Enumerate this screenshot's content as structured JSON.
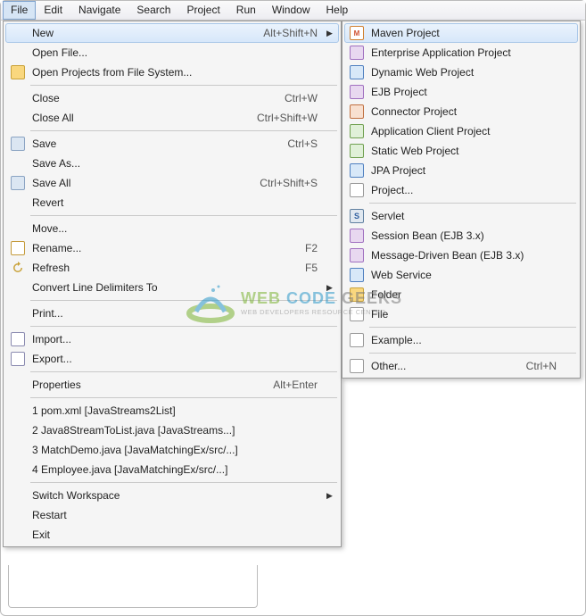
{
  "menubar": {
    "items": [
      "File",
      "Edit",
      "Navigate",
      "Search",
      "Project",
      "Run",
      "Window",
      "Help"
    ]
  },
  "file_menu": {
    "groups": [
      [
        {
          "label": "New",
          "shortcut": "Alt+Shift+N",
          "submenu": true,
          "highlighted": true,
          "icon": ""
        },
        {
          "label": "Open File...",
          "icon": ""
        },
        {
          "label": "Open Projects from File System...",
          "icon": "folder"
        }
      ],
      [
        {
          "label": "Close",
          "shortcut": "Ctrl+W"
        },
        {
          "label": "Close All",
          "shortcut": "Ctrl+Shift+W"
        }
      ],
      [
        {
          "label": "Save",
          "shortcut": "Ctrl+S",
          "icon": "save"
        },
        {
          "label": "Save As..."
        },
        {
          "label": "Save All",
          "shortcut": "Ctrl+Shift+S",
          "icon": "save"
        },
        {
          "label": "Revert"
        }
      ],
      [
        {
          "label": "Move..."
        },
        {
          "label": "Rename...",
          "shortcut": "F2",
          "icon": "edit"
        },
        {
          "label": "Refresh",
          "shortcut": "F5",
          "icon": "refresh"
        },
        {
          "label": "Convert Line Delimiters To",
          "submenu": true
        }
      ],
      [
        {
          "label": "Print..."
        }
      ],
      [
        {
          "label": "Import...",
          "icon": "import"
        },
        {
          "label": "Export...",
          "icon": "import"
        }
      ],
      [
        {
          "label": "Properties",
          "shortcut": "Alt+Enter"
        }
      ],
      [
        {
          "label": "1 pom.xml  [JavaStreams2List]"
        },
        {
          "label": "2 Java8StreamToList.java  [JavaStreams...]"
        },
        {
          "label": "3 MatchDemo.java  [JavaMatchingEx/src/...]"
        },
        {
          "label": "4 Employee.java  [JavaMatchingEx/src/...]"
        }
      ],
      [
        {
          "label": "Switch Workspace",
          "submenu": true
        },
        {
          "label": "Restart"
        },
        {
          "label": "Exit"
        }
      ]
    ]
  },
  "new_submenu": {
    "groups": [
      [
        {
          "label": "Maven Project",
          "icon": "maven",
          "highlighted": true
        },
        {
          "label": "Enterprise Application Project",
          "icon": "ejb"
        },
        {
          "label": "Dynamic Web Project",
          "icon": "web"
        },
        {
          "label": "EJB Project",
          "icon": "ejb"
        },
        {
          "label": "Connector Project",
          "icon": "conn"
        },
        {
          "label": "Application Client Project",
          "icon": "static"
        },
        {
          "label": "Static Web Project",
          "icon": "static"
        },
        {
          "label": "JPA Project",
          "icon": "web"
        },
        {
          "label": "Project...",
          "icon": "file"
        }
      ],
      [
        {
          "label": "Servlet",
          "icon": "servlet"
        },
        {
          "label": "Session Bean (EJB 3.x)",
          "icon": "ejb"
        },
        {
          "label": "Message-Driven Bean (EJB 3.x)",
          "icon": "ejb"
        },
        {
          "label": "Web Service",
          "icon": "web"
        },
        {
          "label": "Folder",
          "icon": "folder2"
        },
        {
          "label": "File",
          "icon": "file"
        }
      ],
      [
        {
          "label": "Example...",
          "icon": "file"
        }
      ],
      [
        {
          "label": "Other...",
          "shortcut": "Ctrl+N",
          "icon": "file"
        }
      ]
    ]
  },
  "watermark": {
    "line1_a": "WEB ",
    "line1_b": "CODE ",
    "line1_c": "GEEKS",
    "line2": "WEB DEVELOPERS RESOURCE CENTER"
  }
}
